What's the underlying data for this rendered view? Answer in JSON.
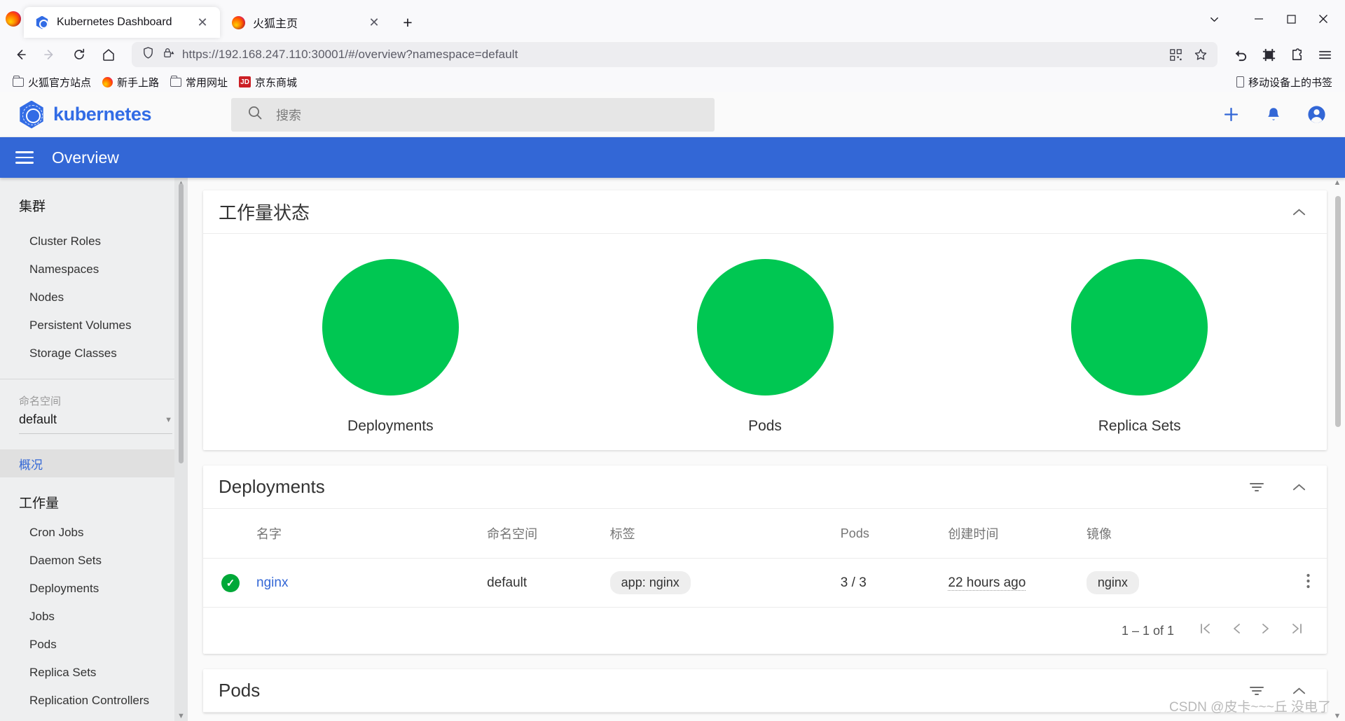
{
  "browser": {
    "tabs": [
      {
        "title": "Kubernetes Dashboard",
        "favicon": "kubernetes-icon",
        "active": true,
        "close_label": "✕"
      },
      {
        "title": "火狐主页",
        "favicon": "firefox-icon",
        "active": false,
        "close_label": "✕"
      }
    ],
    "new_tab_label": "+",
    "window_controls": {
      "list_tabs": "⌄",
      "minimize": "─",
      "maximize": "☐",
      "close": "✕"
    },
    "nav": {
      "back": "←",
      "forward": "→",
      "reload": "⟳",
      "home": "⌂"
    },
    "url": {
      "scheme": "https://",
      "host": "192.168.247.110:30001",
      "path": "/#/overview?namespace=default",
      "full": "https://192.168.247.110:30001/#/overview?namespace=default"
    },
    "url_icons": {
      "shield": "tracking-protection-icon",
      "lock": "lock-warning-icon",
      "qr": "qr-code-icon",
      "bookmark": "bookmark-star-icon"
    },
    "toolbar_right": {
      "undo": "undo-icon",
      "screenshot": "screenshot-crop-icon",
      "extensions": "extensions-puzzle-icon",
      "menu": "app-menu-icon"
    },
    "bookmarks": [
      {
        "label": "火狐官方站点",
        "icon": "folder-icon"
      },
      {
        "label": "新手上路",
        "icon": "firefox-icon"
      },
      {
        "label": "常用网址",
        "icon": "folder-icon"
      },
      {
        "label": "京东商城",
        "icon": "jd-icon",
        "icon_text": "JD"
      }
    ],
    "bookmarks_right": {
      "label": "移动设备上的书签",
      "icon": "mobile-device-icon"
    }
  },
  "dashboard": {
    "brand": "kubernetes",
    "search_placeholder": "搜索",
    "top_actions": {
      "create": "add-icon",
      "notifications": "bell-icon",
      "account": "account-circle-icon"
    },
    "page_title": "Overview",
    "menu_icon": "hamburger-menu-icon",
    "accent_color": "#3367d6",
    "sidebar": {
      "cluster_section": "集群",
      "cluster_items": [
        {
          "label": "Cluster Roles"
        },
        {
          "label": "Namespaces"
        },
        {
          "label": "Nodes"
        },
        {
          "label": "Persistent Volumes"
        },
        {
          "label": "Storage Classes"
        }
      ],
      "namespace_label": "命名空间",
      "namespace_value": "default",
      "overview_item": "概况",
      "workloads_section": "工作量",
      "workload_items": [
        {
          "label": "Cron Jobs"
        },
        {
          "label": "Daemon Sets"
        },
        {
          "label": "Deployments"
        },
        {
          "label": "Jobs"
        },
        {
          "label": "Pods"
        },
        {
          "label": "Replica Sets"
        },
        {
          "label": "Replication Controllers"
        }
      ]
    },
    "workload_status": {
      "title": "工作量状态",
      "collapse_icon": "chevron-up-icon",
      "graphs": [
        {
          "label": "Deployments",
          "color": "#00c752",
          "percent": 100
        },
        {
          "label": "Pods",
          "color": "#00c752",
          "percent": 100
        },
        {
          "label": "Replica Sets",
          "color": "#00c752",
          "percent": 100
        }
      ]
    },
    "deployments": {
      "title": "Deployments",
      "filter_icon": "filter-icon",
      "collapse_icon": "chevron-up-icon",
      "columns": [
        "",
        "名字",
        "命名空间",
        "标签",
        "Pods",
        "创建时间",
        "镜像",
        ""
      ],
      "rows": [
        {
          "status": "ok",
          "status_glyph": "✓",
          "name": "nginx",
          "namespace": "default",
          "labels": "app: nginx",
          "pods": "3 / 3",
          "created": "22 hours ago",
          "images": "nginx",
          "menu": "⋮"
        }
      ],
      "pager": {
        "range": "1 – 1 of 1",
        "first": "|‹",
        "prev": "‹",
        "next": "›",
        "last": "›|"
      }
    },
    "pods_card": {
      "title": "Pods",
      "filter_icon": "filter-icon",
      "collapse_icon": "chevron-up-icon"
    },
    "watermark": "CSDN @皮卡~~~丘 没电了"
  }
}
